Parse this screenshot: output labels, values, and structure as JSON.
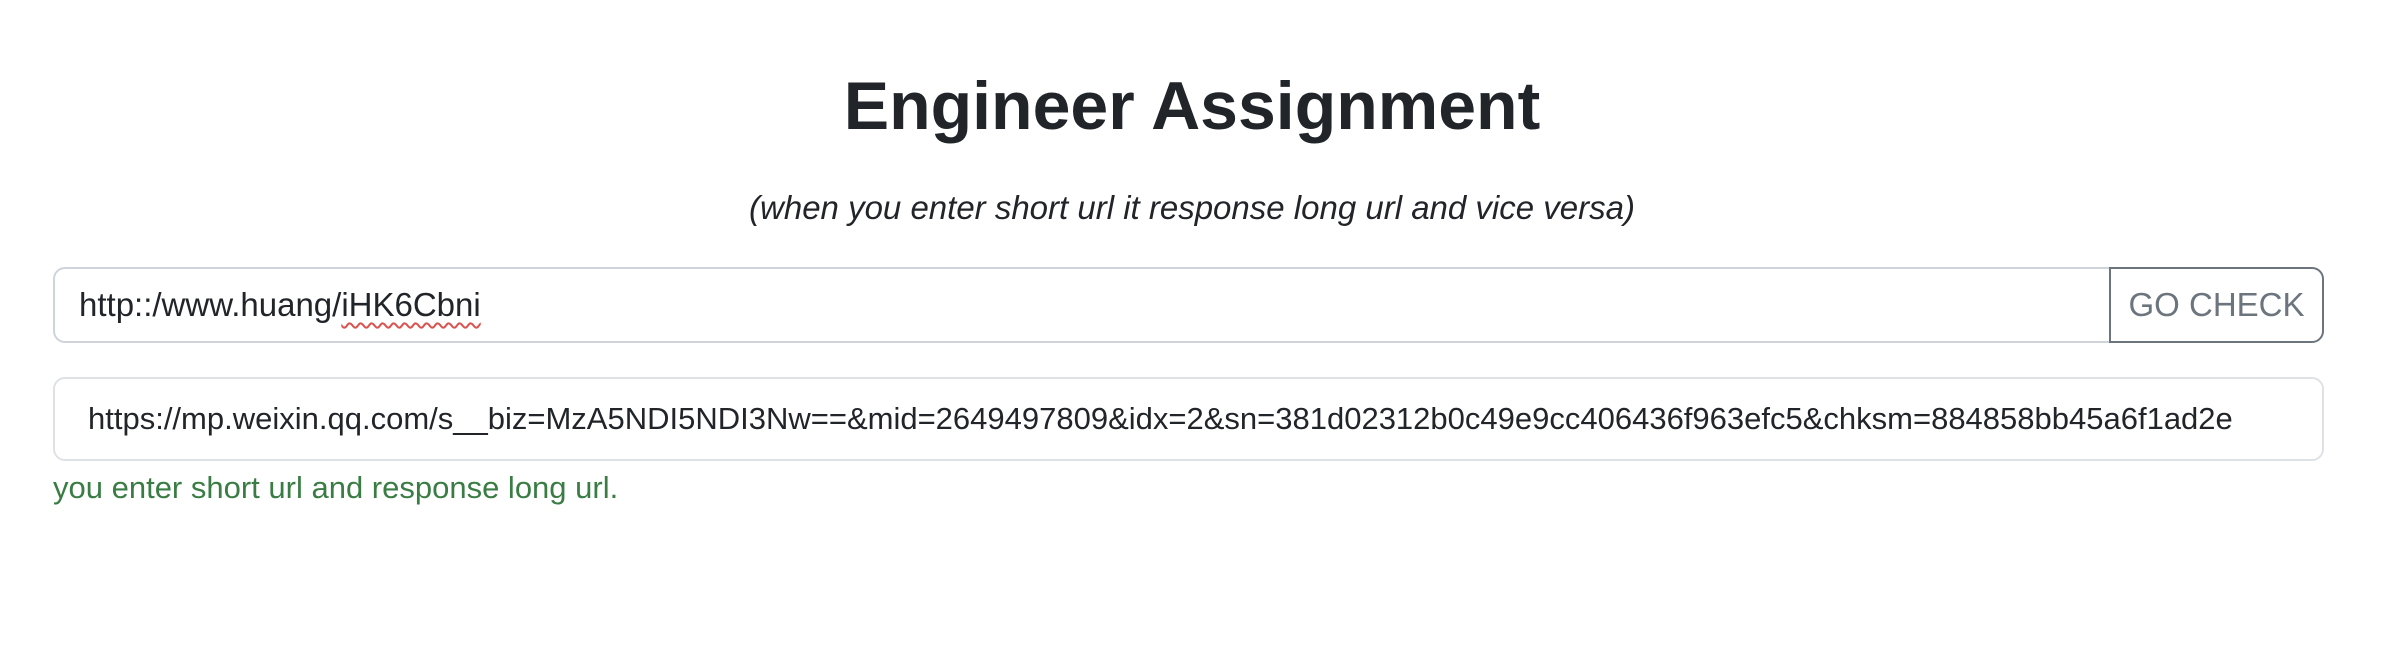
{
  "header": {
    "title": "Engineer Assignment",
    "subtitle": "(when you enter short url it response long url and vice versa)"
  },
  "form": {
    "input_prefix": "http::/www.huang/",
    "input_flagged": "iHK6Cbni",
    "check_button_label": "GO CHECK"
  },
  "result": {
    "url": "https://mp.weixin.qq.com/s__biz=MzA5NDI5NDI3Nw==&mid=2649497809&idx=2&sn=381d02312b0c49e9cc406436f963efc5&chksm=884858bb45a6f1ad2e"
  },
  "status": {
    "message": "you enter short url and response long url.",
    "color": "#3a7d44"
  }
}
